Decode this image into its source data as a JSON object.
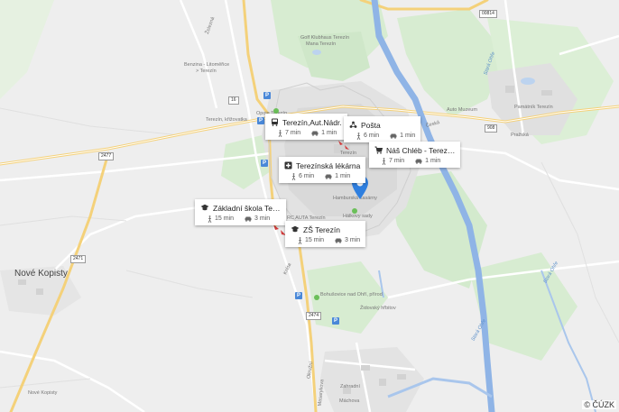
{
  "map": {
    "attribution": "© ČÚZK",
    "towns": {
      "nove_kopisty": "Nové Kopisty",
      "nove_kopisty_small": "Nové Kopisty",
      "terezin": "Terezín"
    },
    "streets": {
      "zahradni": "Zahradní",
      "machova": "Máchova",
      "okruzni": "Okružní",
      "kreta": "Kréta",
      "prazska": "Pražská",
      "ceska": "Česká",
      "zelezna": "Železná",
      "strava_ohre": "Stará Ohře",
      "strava_ohre2": "Stará Ohře",
      "strava_ohre3": "Stará Ohře",
      "masarykova": "Masarykova"
    },
    "places": {
      "golf": "Golf Klubhaus Terezín",
      "golf2": "Mana Terezín",
      "benzina": "Benzina - Litoměřice",
      "benzina2": "> Terezín",
      "kriz": "Terezín, křižovatka",
      "lokal": "Opoje Terezín",
      "muzeum": "Auto Muzeum",
      "pamatnik": "Památník Terezín",
      "hamburska": "Hamburská kasárny",
      "halkovy": "Hálkovy sady",
      "rc": "RC AUTA Terezín",
      "bohusov": "Bohušovice nad Ohří, přírod",
      "zidovsky": "Židovský hřbitov"
    },
    "roads": {
      "r16": "16",
      "r2471": "2471",
      "r2477": "2477",
      "r2474": "2474",
      "r908": "908",
      "r00814": "00814"
    }
  },
  "cards": [
    {
      "id": "autobus",
      "icon": "bus-icon",
      "name": "Terezín,Aut.Nádr.",
      "walk": "7 min",
      "drive": "1 min"
    },
    {
      "id": "posta",
      "icon": "post-office-icon",
      "name": "Pošta",
      "walk": "6 min",
      "drive": "1 min"
    },
    {
      "id": "chleb",
      "icon": "shop-icon",
      "name": "Náš Chléb - Terez…",
      "walk": "7 min",
      "drive": "1 min"
    },
    {
      "id": "lekarna",
      "icon": "pharmacy-icon",
      "name": "Terezínská lékárna",
      "walk": "6 min",
      "drive": "1 min"
    },
    {
      "id": "zakladni",
      "icon": "school-icon",
      "name": "Základní škola Te…",
      "walk": "15 min",
      "drive": "3 min"
    },
    {
      "id": "zs",
      "icon": "school-icon",
      "name": "ZŠ Terezín",
      "walk": "15 min",
      "drive": "3 min"
    }
  ],
  "colors": {
    "river": "#8fb4e6",
    "major_road": "#f7d883",
    "green": "#d7ecd1",
    "marker": "#2f7fdf"
  }
}
